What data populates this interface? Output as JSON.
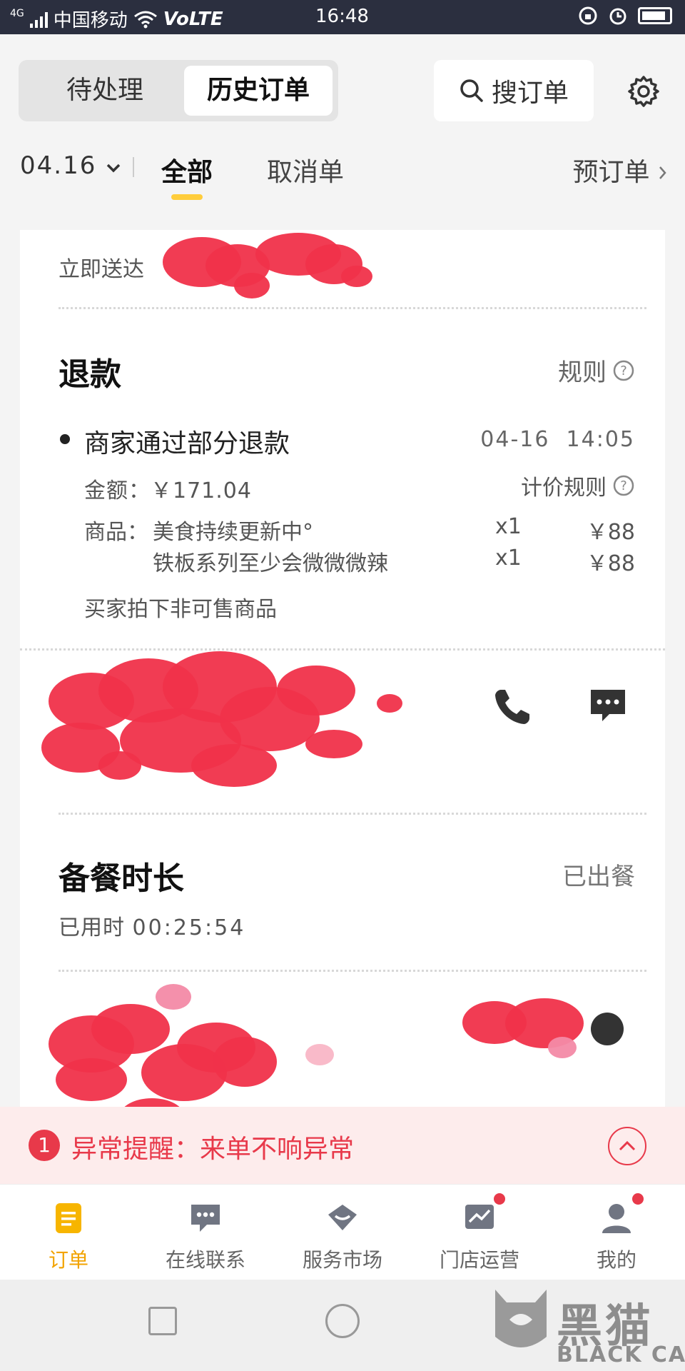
{
  "status_bar": {
    "network": "4G",
    "carrier": "中国移动",
    "volte": "VoLTE",
    "time": "16:48"
  },
  "header": {
    "tabs": [
      "待处理",
      "历史订单"
    ],
    "search_label": "搜订单"
  },
  "filters": {
    "date": "04.16",
    "all": "全部",
    "cancel": "取消单",
    "preorder": "预订单"
  },
  "order": {
    "delivery": "立即送达",
    "refund": {
      "title": "退款",
      "rules_link": "规则",
      "event": "商家通过部分退款",
      "time": "04-16  14:05",
      "amount_label": "金额：",
      "amount": "￥171.04",
      "price_rules": "计价规则",
      "goods_label": "商品：",
      "items": [
        {
          "name": "美食持续更新中°",
          "qty": "x1",
          "price": "￥88"
        },
        {
          "name": "铁板系列至少会微微微辣",
          "qty": "x1",
          "price": "￥88"
        }
      ],
      "reason": "买家拍下非可售商品"
    },
    "prep": {
      "title": "备餐时长",
      "status": "已出餐",
      "elapsed_label": "已用时",
      "elapsed": "00:25:54"
    }
  },
  "alert": {
    "count": "1",
    "message": "异常提醒：来单不响异常"
  },
  "nav": {
    "items": [
      {
        "label": "订单",
        "icon": "order-icon"
      },
      {
        "label": "在线联系",
        "icon": "chat-icon"
      },
      {
        "label": "服务市场",
        "icon": "market-icon"
      },
      {
        "label": "门店运营",
        "icon": "operation-icon"
      },
      {
        "label": "我的",
        "icon": "profile-icon"
      }
    ]
  },
  "watermark": {
    "cn": "黑猫",
    "en": "BLACK CAT"
  },
  "colors": {
    "accent": "#ffcd3c",
    "alert": "#e8394a",
    "active_nav": "#f2a300"
  }
}
